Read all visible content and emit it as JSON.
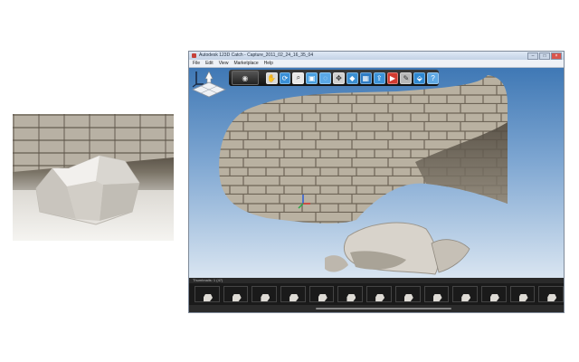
{
  "window": {
    "title": "Autodesk 123D Catch - Capture_2011_02_24_16_35_04",
    "controls": [
      "–",
      "□",
      "×"
    ]
  },
  "menu": [
    "File",
    "Edit",
    "View",
    "Marketplace",
    "Help"
  ],
  "toolbar": {
    "camera_icon": "camera-icon",
    "buttons": [
      {
        "icon": "pan-icon",
        "color": "#d8d8d8"
      },
      {
        "icon": "orbit-icon",
        "color": "#3a8fd6"
      },
      {
        "icon": "zoom-icon",
        "color": "#e8e8e8"
      },
      {
        "icon": "select-icon",
        "color": "#4aa0e0"
      },
      {
        "icon": "lasso-icon",
        "color": "#5aa8e6"
      },
      {
        "icon": "move-icon",
        "color": "#d0d0d0"
      },
      {
        "icon": "mesh-icon",
        "color": "#3b8ed0"
      },
      {
        "icon": "ruler-icon",
        "color": "#2f7cc4"
      },
      {
        "icon": "export-icon",
        "color": "#3c92d8"
      },
      {
        "icon": "video-icon",
        "color": "#d23a2f"
      },
      {
        "icon": "settings-icon",
        "color": "#b8b8b8"
      },
      {
        "icon": "share-icon",
        "color": "#2f88d0"
      },
      {
        "icon": "help-icon",
        "color": "#5fa9e4"
      }
    ]
  },
  "viewport": {
    "axis_label": "x",
    "navigation_icon": "view-cube-icon"
  },
  "filmstrip": {
    "header": "Thumbnails: 1 (47)",
    "thumbnail_count": 13
  }
}
